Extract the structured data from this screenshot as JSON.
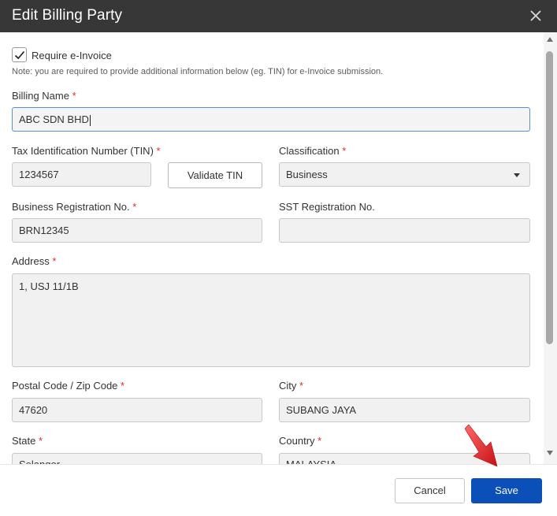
{
  "dialog": {
    "title": "Edit Billing Party",
    "close_icon": "close-icon"
  },
  "form": {
    "require_einvoice": {
      "label": "Require e-Invoice",
      "checked": true
    },
    "note": "Note: you are required to provide additional information below (eg. TIN) for e-Invoice submission.",
    "required_marker": "*",
    "billing_name": {
      "label": "Billing Name",
      "value": "ABC SDN BHD"
    },
    "tin": {
      "label": "Tax Identification Number (TIN)",
      "value": "1234567",
      "validate_label": "Validate TIN"
    },
    "classification": {
      "label": "Classification",
      "value": "Business"
    },
    "brn": {
      "label": "Business Registration No.",
      "value": "BRN12345"
    },
    "sst": {
      "label": "SST Registration No.",
      "value": ""
    },
    "address": {
      "label": "Address",
      "value": "1, USJ 11/1B"
    },
    "postal_code": {
      "label": "Postal Code / Zip Code",
      "value": "47620"
    },
    "city": {
      "label": "City",
      "value": "SUBANG JAYA"
    },
    "state": {
      "label": "State",
      "value": "Selangor"
    },
    "country": {
      "label": "Country",
      "value": "MALAYSIA"
    }
  },
  "footer": {
    "cancel_label": "Cancel",
    "save_label": "Save"
  },
  "colors": {
    "titlebar": "#373737",
    "primary": "#0b4fb8",
    "required": "#e02b2b",
    "annotation_arrow": "#e3191d"
  }
}
